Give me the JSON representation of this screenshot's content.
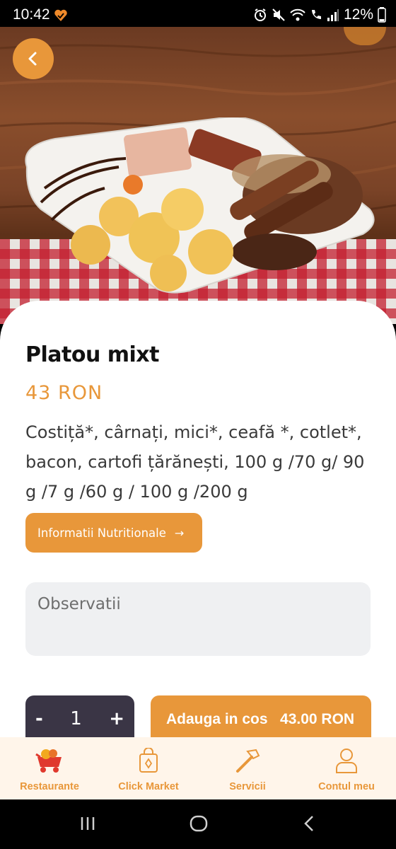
{
  "status_bar": {
    "time": "10:42",
    "battery": "12%"
  },
  "hero": {
    "back_icon": "chevron-left-icon"
  },
  "product": {
    "title": "Platou mixt",
    "price": "43 RON",
    "description": "Costiță*, cârnați, mici*, ceafă *, cotlet*, bacon, cartofi țărănești, 100 g /70 g/ 90 g /7 g /60 g / 100 g /200 g",
    "nutrition_label": "Informatii Nutritionale",
    "nutrition_arrow": "→",
    "notes_placeholder": "Observatii"
  },
  "cart": {
    "minus": "-",
    "quantity": "1",
    "plus": "+",
    "add_label": "Adauga in cos   43.00 RON"
  },
  "bottom_nav": [
    {
      "label": "Restaurante",
      "icon": "food-cart-icon"
    },
    {
      "label": "Click Market",
      "icon": "shopping-bag-icon"
    },
    {
      "label": "Servicii",
      "icon": "hammer-icon"
    },
    {
      "label": "Contul meu",
      "icon": "user-icon"
    }
  ],
  "colors": {
    "accent": "#e8973a",
    "dark": "#3a3545",
    "nav_bg": "#fff5ea"
  }
}
